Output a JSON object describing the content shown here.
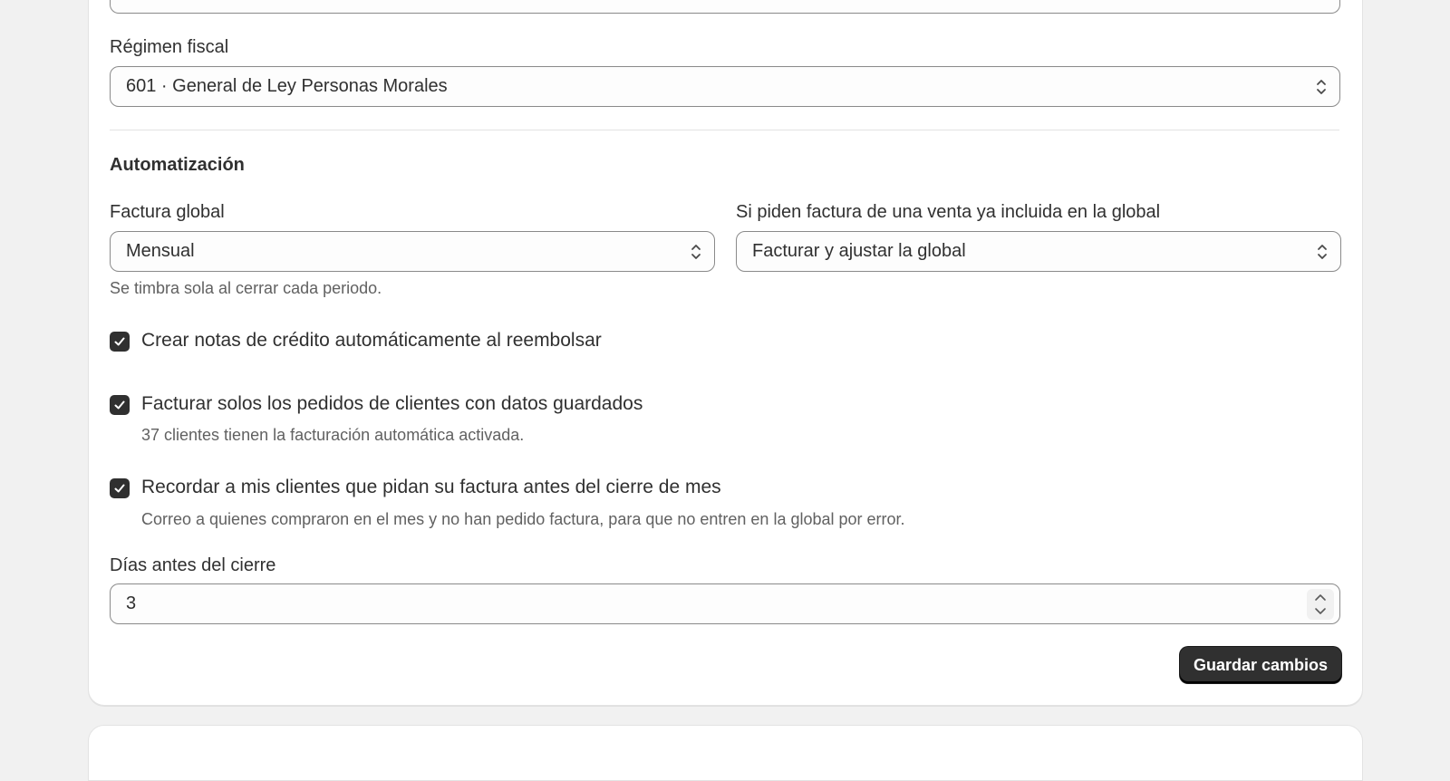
{
  "fiscal": {
    "label": "Régimen fiscal",
    "value": "601 · General de Ley Personas Morales"
  },
  "automation": {
    "heading": "Automatización",
    "global_invoice": {
      "label": "Factura global",
      "value": "Mensual",
      "help": "Se timbra sola al cerrar cada periodo."
    },
    "included_sale": {
      "label": "Si piden factura de una venta ya incluida en la global",
      "value": "Facturar y ajustar la global"
    },
    "options": [
      {
        "label": "Crear notas de crédito automáticamente al reembolsar",
        "checked": true,
        "help": ""
      },
      {
        "label": "Facturar solos los pedidos de clientes con datos guardados",
        "checked": true,
        "help": "37 clientes tienen la facturación automática activada."
      },
      {
        "label": "Recordar a mis clientes que pidan su factura antes del cierre de mes",
        "checked": true,
        "help": "Correo a quienes compraron en el mes y no han pedido factura, para que no entren en la global por error."
      }
    ],
    "days_before": {
      "label": "Días antes del cierre",
      "value": "3"
    }
  },
  "actions": {
    "save_label": "Guardar cambios"
  },
  "colors": {
    "page_bg": "#f1f1f1",
    "card_bg": "#ffffff",
    "primary_button": "#303030",
    "checkbox": "#303030"
  }
}
